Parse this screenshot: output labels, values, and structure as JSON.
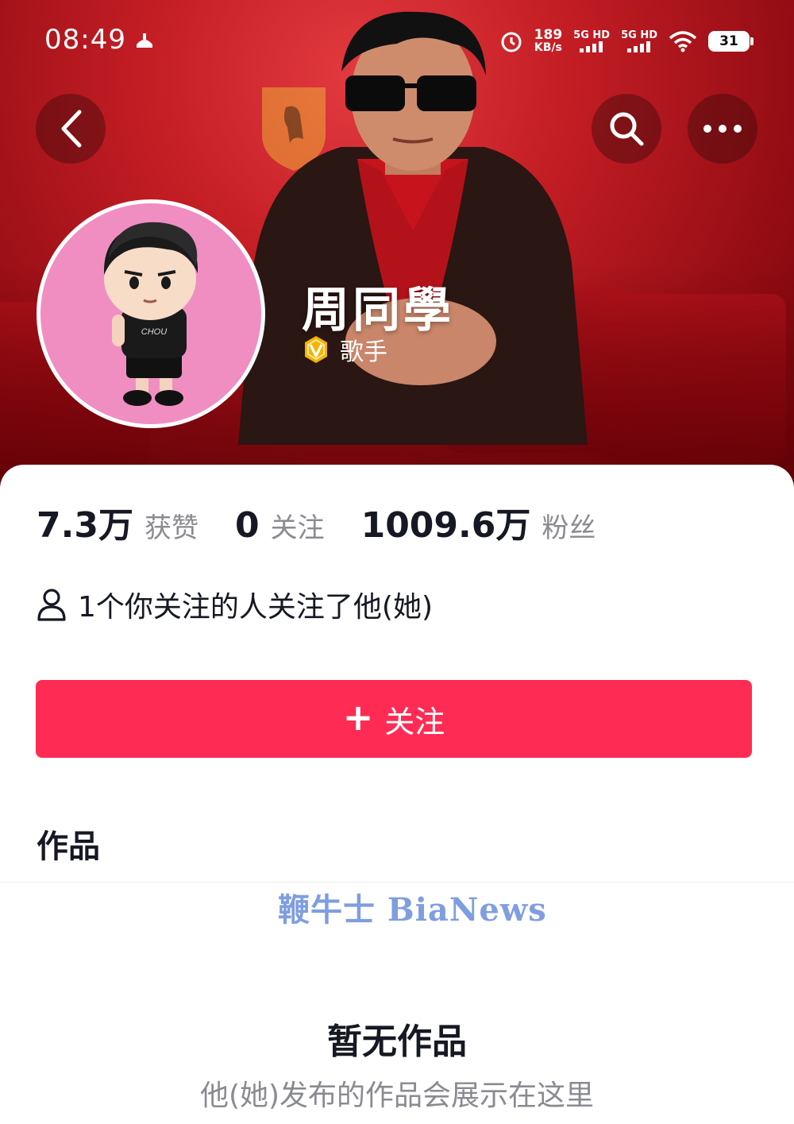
{
  "status_bar": {
    "time": "08:49",
    "net_speed": "189",
    "net_unit": "KB/s",
    "sim1": "5G HD",
    "sim2": "5G HD",
    "battery": "31"
  },
  "profile": {
    "nickname": "周同學",
    "verify_label": "歌手",
    "avatar_text": "CHOU CHOU"
  },
  "stats": [
    {
      "value": "7.3万",
      "label": "获赞"
    },
    {
      "value": "0",
      "label": "关注"
    },
    {
      "value": "1009.6万",
      "label": "粉丝"
    }
  ],
  "mutual_text": "1个你关注的人关注了他(她)",
  "follow_button": {
    "icon": "+",
    "label": "关注"
  },
  "works_tab": "作品",
  "watermark": "鞭牛士 BiaNews",
  "empty_state": {
    "title": "暂无作品",
    "subtitle": "他(她)发布的作品会展示在这里"
  },
  "colors": {
    "accent": "#fe2c55",
    "banner": "#c31d24",
    "verify_badge": "#f5b400"
  }
}
